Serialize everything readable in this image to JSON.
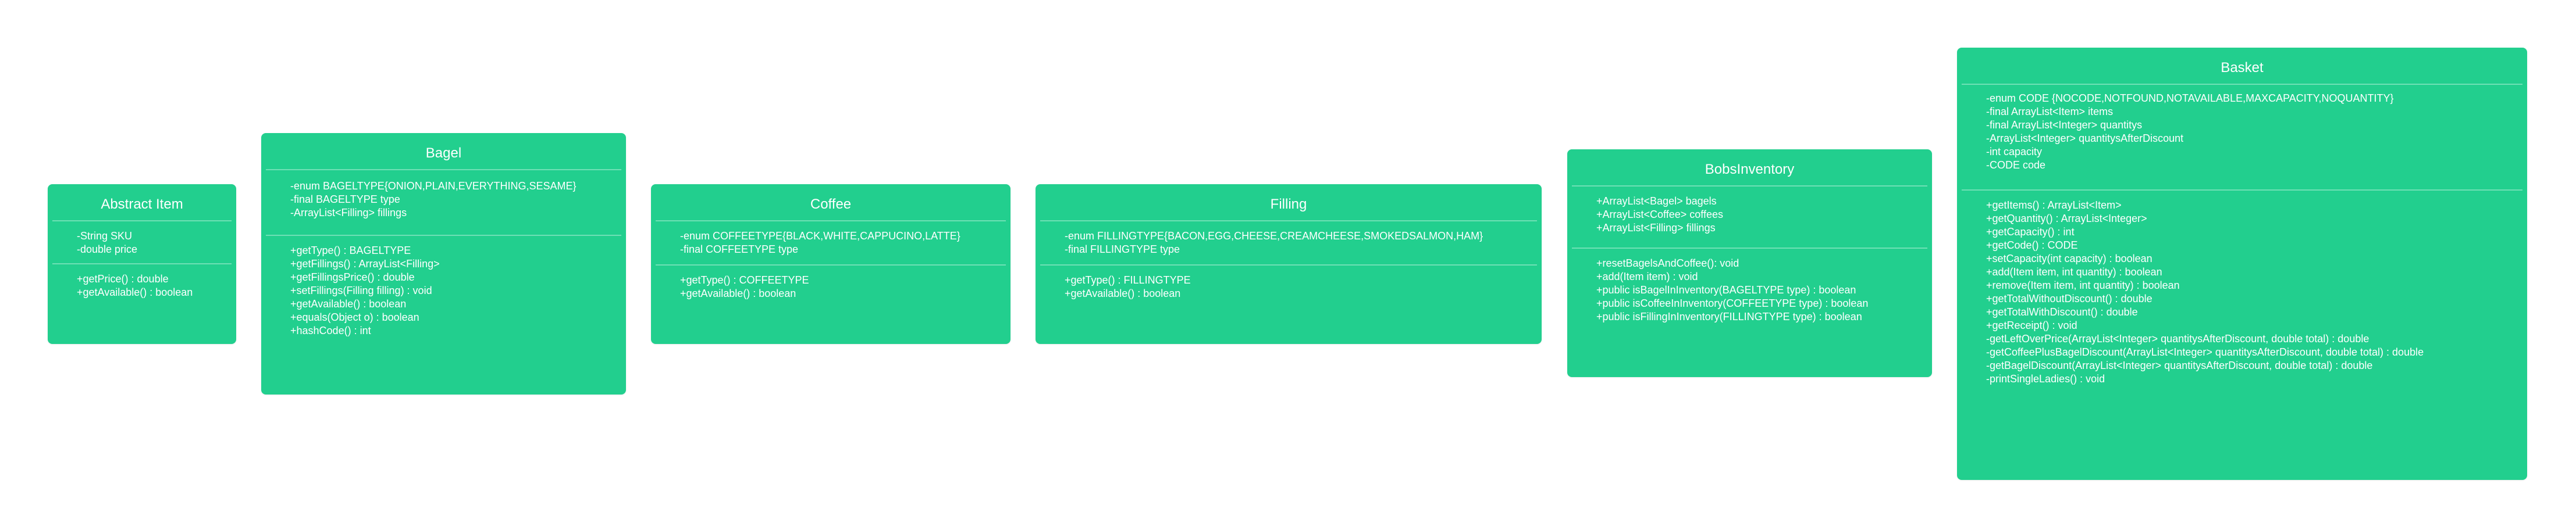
{
  "diagram": {
    "classes": [
      {
        "id": "abstract-item",
        "name": "Abstract Item",
        "attributes": [
          "-String SKU",
          "-double price"
        ],
        "methods": [
          "+getPrice() : double",
          "+getAvailable() : boolean"
        ]
      },
      {
        "id": "bagel",
        "name": "Bagel",
        "attributes": [
          "-enum BAGELTYPE{ONION,PLAIN,EVERYTHING,SESAME}",
          "-final BAGELTYPE type",
          "-ArrayList<Filling> fillings"
        ],
        "methods": [
          "+getType() : BAGELTYPE",
          "+getFillings() : ArrayList<Filling>",
          "+getFillingsPrice() : double",
          "+setFillings(Filling filling) : void",
          "+getAvailable() : boolean",
          "+equals(Object o) : boolean",
          "+hashCode() : int"
        ]
      },
      {
        "id": "coffee",
        "name": "Coffee",
        "attributes": [
          "-enum COFFEETYPE{BLACK,WHITE,CAPPUCINO,LATTE}",
          "-final COFFEETYPE type"
        ],
        "methods": [
          "+getType() : COFFEETYPE",
          "+getAvailable() : boolean"
        ]
      },
      {
        "id": "filling",
        "name": "Filling",
        "attributes": [
          "-enum FILLINGTYPE{BACON,EGG,CHEESE,CREAMCHEESE,SMOKEDSALMON,HAM}",
          "-final FILLINGTYPE type"
        ],
        "methods": [
          "+getType() : FILLINGTYPE",
          "+getAvailable() : boolean"
        ]
      },
      {
        "id": "bobsinventory",
        "name": "BobsInventory",
        "attributes": [
          "+ArrayList<Bagel> bagels",
          "+ArrayList<Coffee> coffees",
          "+ArrayList<Filling> fillings"
        ],
        "methods": [
          "+resetBagelsAndCoffee(): void",
          "+add(Item item) : void",
          "+public isBagelInInventory(BAGELTYPE type) : boolean",
          "+public isCoffeeInInventory(COFFEETYPE type) : boolean",
          "+public isFillingInInventory(FILLINGTYPE type) : boolean"
        ]
      },
      {
        "id": "basket",
        "name": "Basket",
        "attributes": [
          "-enum CODE {NOCODE,NOTFOUND,NOTAVAILABLE,MAXCAPACITY,NOQUANTITY}",
          "-final ArrayList<Item> items",
          "-final ArrayList<Integer> quantitys",
          "-ArrayList<Integer> quantitysAfterDiscount",
          "-int capacity",
          "-CODE code"
        ],
        "methods": [
          "+getItems() : ArrayList<Item>",
          "+getQuantity() : ArrayList<Integer>",
          "+getCapacity() : int",
          "+getCode() : CODE",
          "+setCapacity(int capacity) : boolean",
          "+add(Item item, int quantity) : boolean",
          "+remove(Item item, int quantity) : boolean",
          "+getTotalWithoutDiscount() : double",
          "+getTotalWithDiscount() : double",
          "+getReceipt() : void",
          "-getLeftOverPrice(ArrayList<Integer> quantitysAfterDiscount, double total) : double",
          "-getCoffeePlusBagelDiscount(ArrayList<Integer> quantitysAfterDiscount, double total) : double",
          "-getBagelDiscount(ArrayList<Integer> quantitysAfterDiscount, double total) : double",
          "-printSingleLadies() : void"
        ]
      }
    ]
  },
  "colors": {
    "box": "#22cf8e",
    "text": "#ffffff",
    "background": "#ffffff"
  }
}
